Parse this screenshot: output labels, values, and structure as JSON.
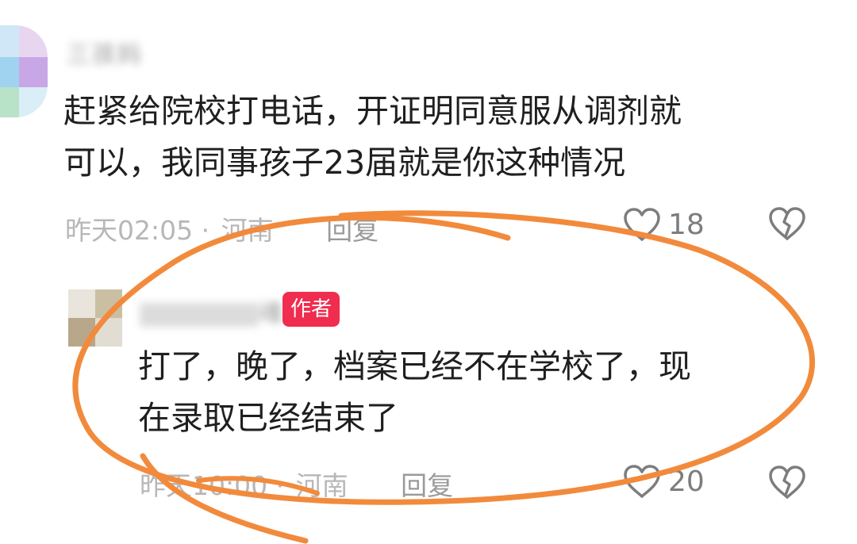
{
  "comments": [
    {
      "username": "三孩妈",
      "text_lines": [
        "赶紧给院校打电话，开证明同意服从调剂就",
        "可以，我同事孩子23届就是你这种情况"
      ],
      "time": "昨天02:05",
      "separator": "·",
      "region": "河南",
      "reply": "回复",
      "likes": "18",
      "icons": {
        "like": "heart-outline-icon",
        "dislike": "broken-heart-icon"
      }
    },
    {
      "username": "魂",
      "badge": "作者",
      "text_lines": [
        "打了，晚了，档案已经不在学校了，现",
        "在录取已经结束了"
      ],
      "time": "昨天10:00",
      "separator": "·",
      "region": "河南",
      "reply": "回复",
      "likes": "20",
      "icons": {
        "like": "heart-outline-icon",
        "dislike": "broken-heart-icon"
      }
    }
  ],
  "colors": {
    "badge_bg": "#f02d4e",
    "annotation_stroke": "#f28a3c",
    "meta_text": "#b7b7b7",
    "icon": "#7d7d7d"
  }
}
